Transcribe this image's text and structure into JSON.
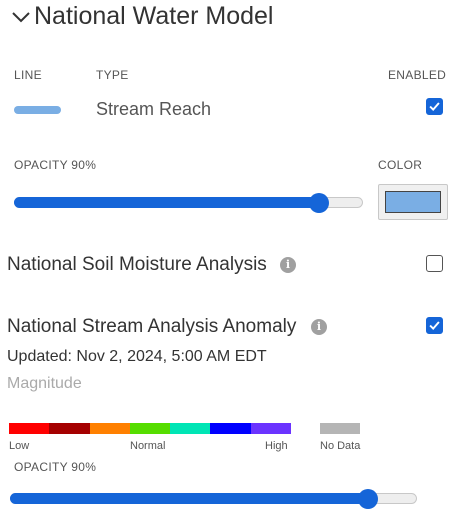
{
  "header": {
    "title": "National Water Model",
    "expand_icon": "chevron-down-icon"
  },
  "layer": {
    "col_line": "LINE",
    "col_type": "TYPE",
    "col_enabled": "ENABLED",
    "type": "Stream Reach",
    "line_color": "#7aaee4",
    "enabled": true,
    "opacity_label": "OPACITY 90%",
    "opacity": 0.9,
    "color_label": "COLOR",
    "color": "#7aaee4"
  },
  "soil": {
    "title": "National Soil Moisture Analysis",
    "info_icon": "info-icon",
    "enabled": false
  },
  "anomaly": {
    "title": "National Stream Analysis Anomaly",
    "info_icon": "info-icon",
    "enabled": true,
    "updated": "Updated: Nov 2, 2024, 5:00 AM EDT",
    "magnitude_label": "Magnitude",
    "legend_colors": [
      "#ff0000",
      "#a50000",
      "#ff8000",
      "#56dd00",
      "#00e5b5",
      "#0000ff",
      "#6b33ff"
    ],
    "legend_low": "Low",
    "legend_normal": "Normal",
    "legend_high": "High",
    "legend_nodata": "No Data",
    "nodata_color": "#b5b5b5",
    "opacity_label": "OPACITY 90%",
    "opacity": 0.9
  },
  "colors": {
    "accent": "#1565d8"
  }
}
